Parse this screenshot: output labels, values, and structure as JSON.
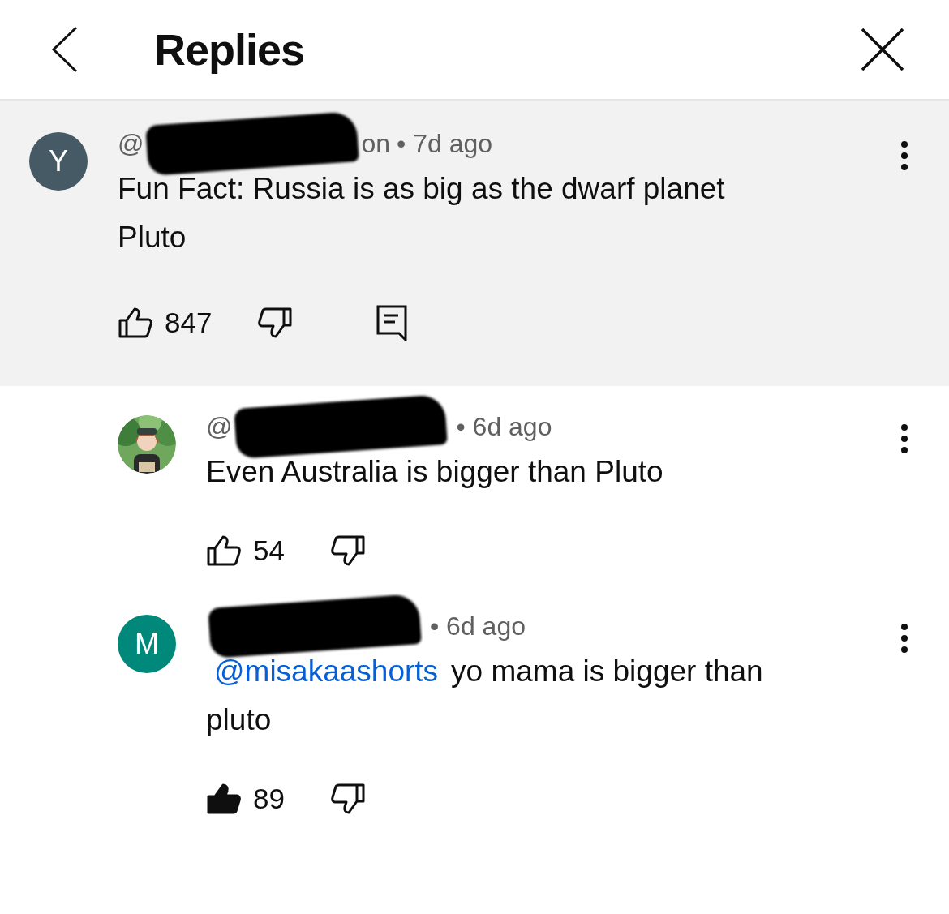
{
  "header": {
    "title": "Replies"
  },
  "comments": [
    {
      "kind": "top",
      "avatar": {
        "kind": "letter",
        "letter": "Y",
        "color": "#455a64"
      },
      "handle_start": "@",
      "handle_end": "on",
      "time": "• 7d ago",
      "text": "Fun Fact: Russia is as big as the dwarf planet Pluto",
      "likes": "847",
      "liked": false,
      "reply_button": true
    },
    {
      "kind": "reply",
      "handle_start": "@",
      "time": "• 6d ago",
      "text": "Even Australia is bigger than Pluto",
      "likes": "54",
      "liked": false,
      "reply_button": false
    },
    {
      "kind": "reply",
      "avatar": {
        "kind": "letter",
        "letter": "M",
        "color": "#00897b"
      },
      "time": "• 6d ago",
      "mention": "@misakaashorts",
      "text": "yo mama is bigger than pluto",
      "likes": "89",
      "liked": true,
      "reply_button": false
    }
  ]
}
